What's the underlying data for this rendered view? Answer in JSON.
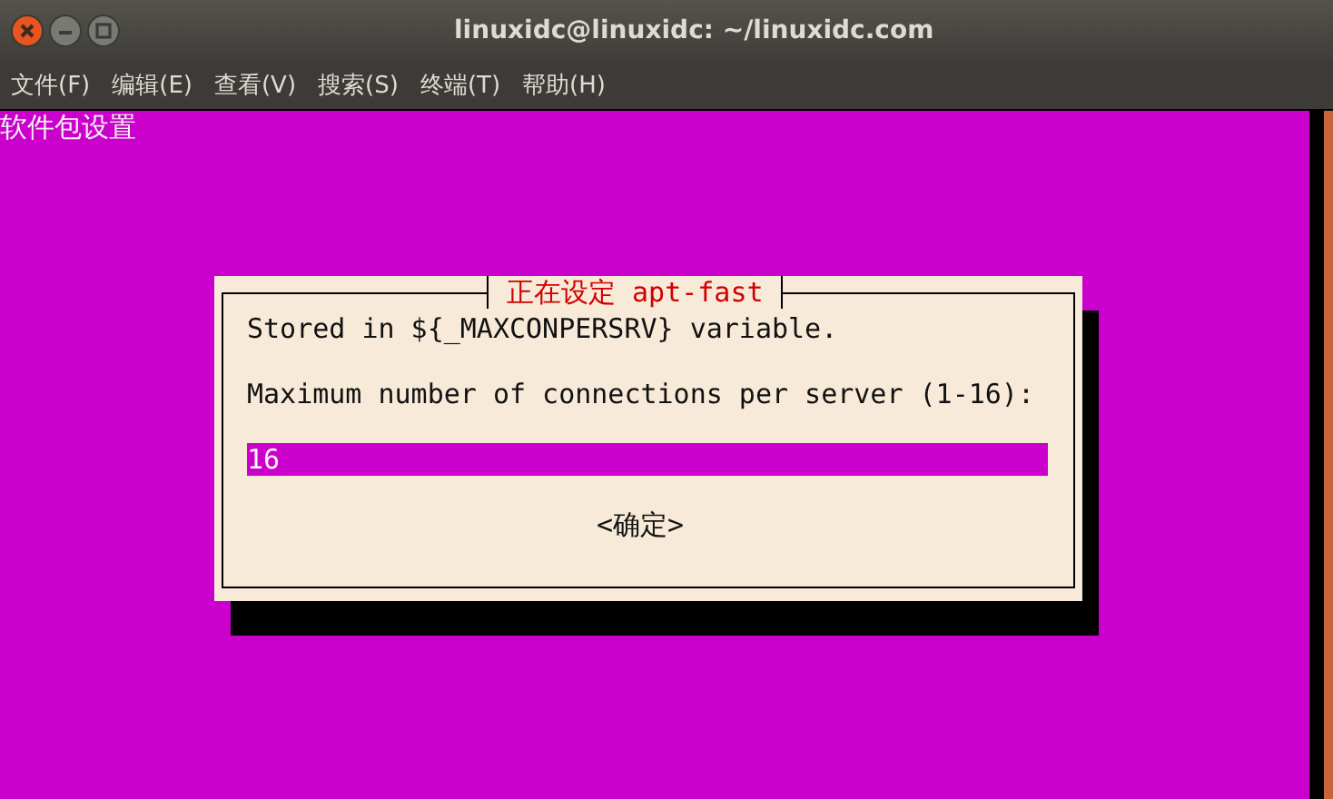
{
  "window": {
    "title": "linuxidc@linuxidc: ~/linuxidc.com"
  },
  "menu": [
    "文件(F)",
    "编辑(E)",
    "查看(V)",
    "搜索(S)",
    "终端(T)",
    "帮助(H)"
  ],
  "terminal": {
    "heading": "软件包设置",
    "dialog": {
      "title": "正在设定 apt-fast",
      "lines": [
        "Stored in ${_MAXCONPERSRV} variable.",
        "Maximum number of connections per server (1-16):"
      ],
      "input": {
        "value": "16"
      },
      "buttons": [
        "<确定>"
      ]
    }
  }
}
